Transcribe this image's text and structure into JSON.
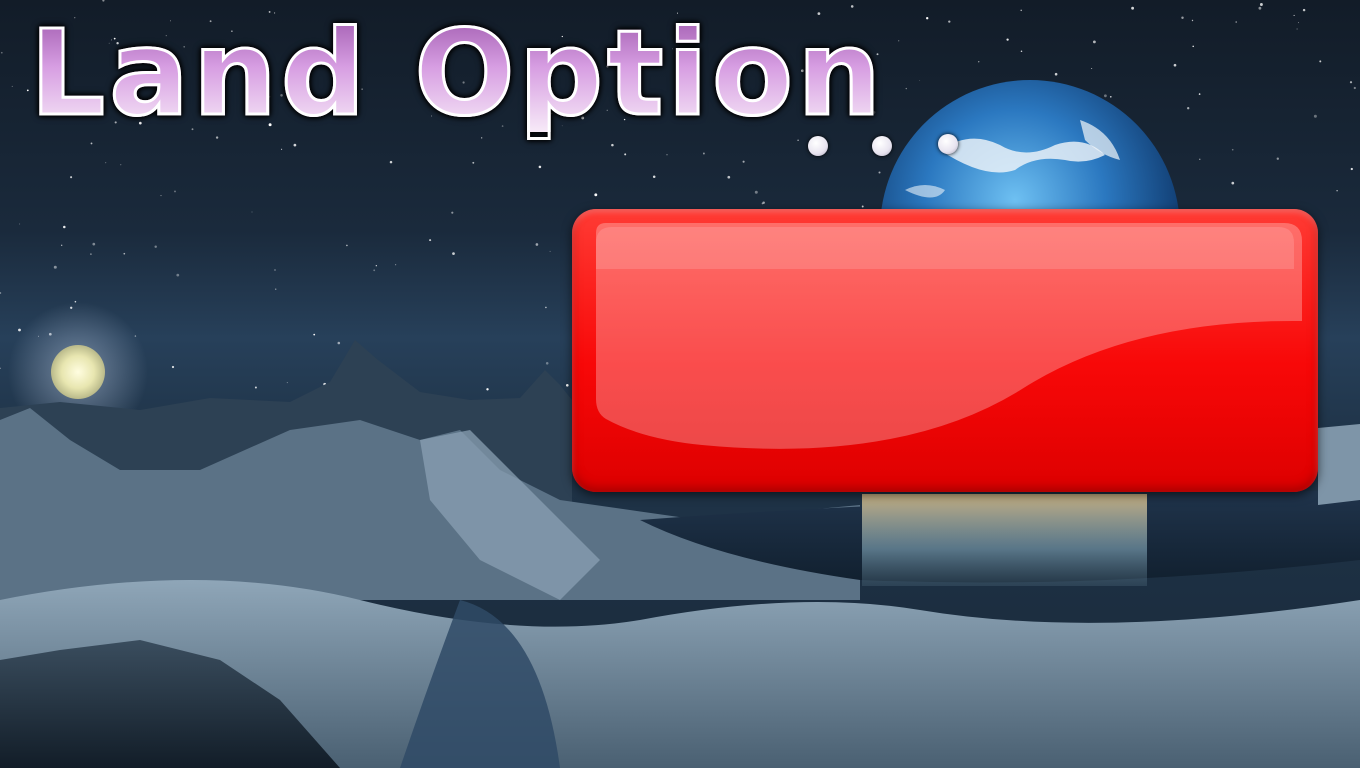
{
  "screen": {
    "title": "Land Option",
    "ellipsis": ". . .",
    "answer_button_label": ""
  },
  "colors": {
    "title_fill_top": "#a15cb0",
    "title_fill_bottom": "#f7eaf8",
    "title_outline": "#ffffff",
    "button_red": "#f80808",
    "sky": "#121c28",
    "ocean_planet": "#2b78c0"
  },
  "icons": {
    "background": "alien-landscape-illustration",
    "planet": "earth-planet-icon",
    "moon": "moon-icon"
  }
}
